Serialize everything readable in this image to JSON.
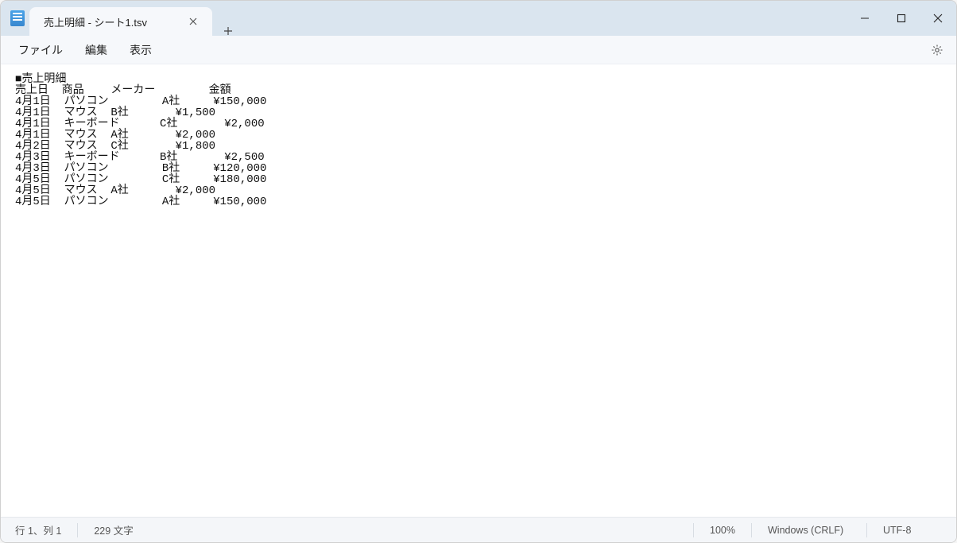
{
  "window": {
    "tab_title": "売上明細 - シート1.tsv"
  },
  "menu": {
    "file": "ファイル",
    "edit": "編集",
    "view": "表示"
  },
  "content": {
    "title_line": "■売上明細",
    "header": {
      "date": "売上日",
      "product": "商品",
      "maker": "メーカー",
      "amount": "金額"
    },
    "rows": [
      {
        "date": "4月1日",
        "product": "パソコン",
        "maker": "A社",
        "amount": "¥150,000"
      },
      {
        "date": "4月1日",
        "product": "マウス",
        "maker": "B社",
        "amount": "¥1,500"
      },
      {
        "date": "4月1日",
        "product": "キーボード",
        "maker": "C社",
        "amount": "¥2,000"
      },
      {
        "date": "4月1日",
        "product": "マウス",
        "maker": "A社",
        "amount": "¥2,000"
      },
      {
        "date": "4月2日",
        "product": "マウス",
        "maker": "C社",
        "amount": "¥1,800"
      },
      {
        "date": "4月3日",
        "product": "キーボード",
        "maker": "B社",
        "amount": "¥2,500"
      },
      {
        "date": "4月3日",
        "product": "パソコン",
        "maker": "B社",
        "amount": "¥120,000"
      },
      {
        "date": "4月5日",
        "product": "パソコン",
        "maker": "C社",
        "amount": "¥180,000"
      },
      {
        "date": "4月5日",
        "product": "マウス",
        "maker": "A社",
        "amount": "¥2,000"
      },
      {
        "date": "4月5日",
        "product": "パソコン",
        "maker": "A社",
        "amount": "¥150,000"
      }
    ]
  },
  "status": {
    "position": "行 1、列 1",
    "chars": "229 文字",
    "zoom": "100%",
    "line_ending": "Windows (CRLF)",
    "encoding": "UTF-8"
  }
}
